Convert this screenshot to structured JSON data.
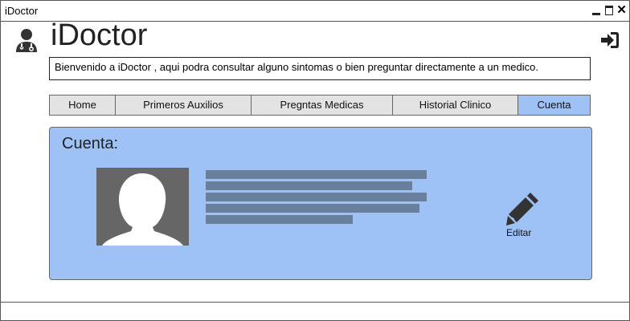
{
  "window": {
    "title": "iDoctor"
  },
  "header": {
    "app_title": "iDoctor",
    "logo_icon": "doctor-icon",
    "logout_icon": "sign-in-icon"
  },
  "welcome_text": "Bienvenido a iDoctor , aqui podra consultar alguno sintomas o bien preguntar directamente a un medico.",
  "tabs": [
    {
      "label": "Home",
      "active": false
    },
    {
      "label": "Primeros Auxilios",
      "active": false
    },
    {
      "label": "Pregntas Medicas",
      "active": false
    },
    {
      "label": "Historial Clinico",
      "active": false
    },
    {
      "label": "Cuenta",
      "active": true
    }
  ],
  "account": {
    "title": "Cuenta:",
    "avatar_icon": "user-silhouette-icon",
    "edit_icon": "pencil-icon",
    "edit_label": "Editar"
  },
  "colors": {
    "accent": "#9ec2f6",
    "tab_bg": "#e3e3e3",
    "placeholder_bar": "#68809e",
    "avatar_bg": "#666666"
  }
}
